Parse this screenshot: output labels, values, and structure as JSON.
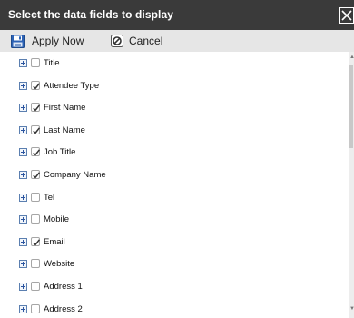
{
  "dialog": {
    "title": "Select the data fields to display",
    "close_icon": "close-x-icon"
  },
  "toolbar": {
    "apply_label": "Apply Now",
    "apply_icon": "save-disk-icon",
    "cancel_label": "Cancel",
    "cancel_icon": "cancel-circle-slash-icon"
  },
  "fields": [
    {
      "label": "Title",
      "checked": false
    },
    {
      "label": "Attendee Type",
      "checked": true
    },
    {
      "label": "First Name",
      "checked": true
    },
    {
      "label": "Last Name",
      "checked": true
    },
    {
      "label": "Job Title",
      "checked": true
    },
    {
      "label": "Company Name",
      "checked": true
    },
    {
      "label": "Tel",
      "checked": false
    },
    {
      "label": "Mobile",
      "checked": false
    },
    {
      "label": "Email",
      "checked": true
    },
    {
      "label": "Website",
      "checked": false
    },
    {
      "label": "Address 1",
      "checked": false
    },
    {
      "label": "Address 2",
      "checked": false
    }
  ],
  "colors": {
    "titlebar_bg": "#3a3a3a",
    "toolbar_bg": "#e6e6e6",
    "accent": "#2c55a0"
  }
}
